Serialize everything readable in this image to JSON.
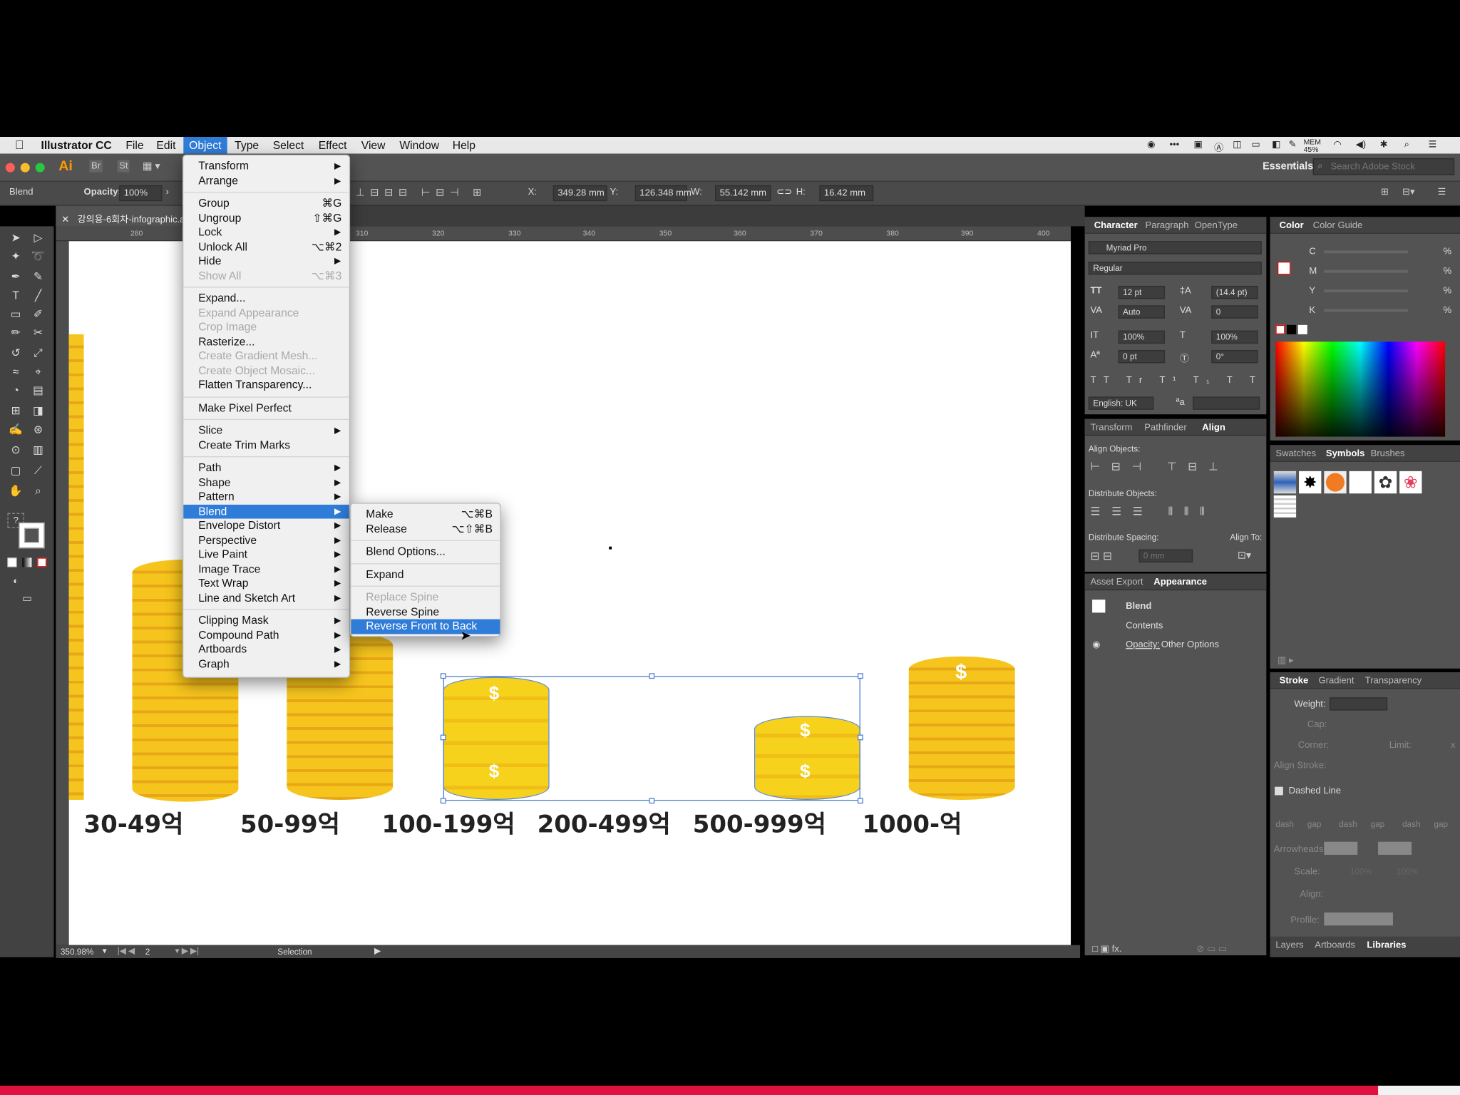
{
  "menubar": {
    "apple": "",
    "app": "Illustrator CC",
    "items": [
      "File",
      "Edit",
      "Object",
      "Type",
      "Select",
      "Effect",
      "View",
      "Window",
      "Help"
    ],
    "tray_battery": "MEM 45%"
  },
  "appbar": {
    "logo": "Ai",
    "br": "Br",
    "st": "St",
    "workspace": "Essentials",
    "search_placeholder": "Search Adobe Stock"
  },
  "control_bar": {
    "type": "Blend",
    "opacity_label": "Opacity:",
    "opacity": "100%",
    "x_label": "X:",
    "x": "349.28 mm",
    "y_label": "Y:",
    "y": "126.348 mm",
    "w_label": "W:",
    "w": "55.142 mm",
    "h_label": "H:",
    "h": "16.42 mm"
  },
  "document": {
    "tab": "강의용-6회차-infographic.ai*",
    "ruler_ticks": [
      "280",
      "310",
      "320",
      "330",
      "340",
      "350",
      "360",
      "370",
      "380",
      "390",
      "400"
    ],
    "zoom": "350.98%",
    "artboard": "2",
    "status": "Selection"
  },
  "canvas": {
    "labels": [
      "30-49억",
      "50-99억",
      "100-199억",
      "200-499억",
      "500-999억",
      "1000-억"
    ],
    "coin_symbol": "$"
  },
  "object_menu": {
    "items": [
      {
        "label": "Transform",
        "arrow": true
      },
      {
        "label": "Arrange",
        "arrow": true
      },
      {
        "sep": true
      },
      {
        "label": "Group",
        "shortcut": "⌘G"
      },
      {
        "label": "Ungroup",
        "shortcut": "⇧⌘G"
      },
      {
        "label": "Lock",
        "arrow": true
      },
      {
        "label": "Unlock All",
        "shortcut": "⌥⌘2"
      },
      {
        "label": "Hide",
        "arrow": true
      },
      {
        "label": "Show All",
        "shortcut": "⌥⌘3",
        "disabled": true
      },
      {
        "sep": true
      },
      {
        "label": "Expand..."
      },
      {
        "label": "Expand Appearance",
        "disabled": true
      },
      {
        "label": "Crop Image",
        "disabled": true
      },
      {
        "label": "Rasterize..."
      },
      {
        "label": "Create Gradient Mesh...",
        "disabled": true
      },
      {
        "label": "Create Object Mosaic...",
        "disabled": true
      },
      {
        "label": "Flatten Transparency..."
      },
      {
        "sep": true
      },
      {
        "label": "Make Pixel Perfect"
      },
      {
        "sep": true
      },
      {
        "label": "Slice",
        "arrow": true
      },
      {
        "label": "Create Trim Marks"
      },
      {
        "sep": true
      },
      {
        "label": "Path",
        "arrow": true
      },
      {
        "label": "Shape",
        "arrow": true
      },
      {
        "label": "Pattern",
        "arrow": true
      },
      {
        "label": "Blend",
        "arrow": true,
        "highlight": true
      },
      {
        "label": "Envelope Distort",
        "arrow": true
      },
      {
        "label": "Perspective",
        "arrow": true
      },
      {
        "label": "Live Paint",
        "arrow": true
      },
      {
        "label": "Image Trace",
        "arrow": true
      },
      {
        "label": "Text Wrap",
        "arrow": true
      },
      {
        "label": "Line and Sketch Art",
        "arrow": true
      },
      {
        "sep": true
      },
      {
        "label": "Clipping Mask",
        "arrow": true
      },
      {
        "label": "Compound Path",
        "arrow": true
      },
      {
        "label": "Artboards",
        "arrow": true
      },
      {
        "label": "Graph",
        "arrow": true
      }
    ]
  },
  "blend_menu": {
    "items": [
      {
        "label": "Make",
        "shortcut": "⌥⌘B"
      },
      {
        "label": "Release",
        "shortcut": "⌥⇧⌘B"
      },
      {
        "sep": true
      },
      {
        "label": "Blend Options..."
      },
      {
        "sep": true
      },
      {
        "label": "Expand"
      },
      {
        "sep": true
      },
      {
        "label": "Replace Spine",
        "disabled": true
      },
      {
        "label": "Reverse Spine"
      },
      {
        "label": "Reverse Front to Back",
        "highlight": true
      }
    ]
  },
  "character_panel": {
    "tabs": [
      "Character",
      "Paragraph",
      "OpenType"
    ],
    "font": "Myriad Pro",
    "style": "Regular",
    "size": "12 pt",
    "leading": "(14.4 pt)",
    "kerning": "Auto",
    "tracking": "0",
    "vscale": "100%",
    "hscale": "100%",
    "baseline": "0 pt",
    "rotation": "0°",
    "language": "English: UK"
  },
  "align_panel": {
    "tabs": [
      "Transform",
      "Pathfinder",
      "Align"
    ],
    "align_objects": "Align Objects:",
    "distribute_objects": "Distribute Objects:",
    "distribute_spacing": "Distribute Spacing:",
    "align_to": "Align To:",
    "spacing_value": "0 mm"
  },
  "appearance_panel": {
    "tabs": [
      "Asset Export",
      "Appearance"
    ],
    "title": "Blend",
    "contents": "Contents",
    "opacity_label": "Opacity:",
    "opacity_value": "Other Options"
  },
  "color_panel": {
    "tabs": [
      "Color",
      "Color Guide"
    ],
    "channels": [
      "C",
      "M",
      "Y",
      "K"
    ],
    "unit": "%"
  },
  "symbols_panel": {
    "tabs": [
      "Swatches",
      "Symbols",
      "Brushes"
    ]
  },
  "stroke_panel": {
    "tabs": [
      "Stroke",
      "Gradient",
      "Transparency"
    ],
    "weight": "Weight:",
    "cap": "Cap:",
    "corner": "Corner:",
    "limit": "Limit:",
    "limit_x": "x",
    "align_stroke": "Align Stroke:",
    "dashed_line": "Dashed Line",
    "dash_labels": [
      "dash",
      "gap",
      "dash",
      "gap",
      "dash",
      "gap"
    ],
    "arrowheads": "Arrowheads:",
    "scale": "Scale:",
    "scale_values": [
      "100%",
      "100%"
    ],
    "align": "Align:",
    "profile": "Profile:"
  },
  "bottom_tabs": [
    "Layers",
    "Artboards",
    "Libraries"
  ]
}
